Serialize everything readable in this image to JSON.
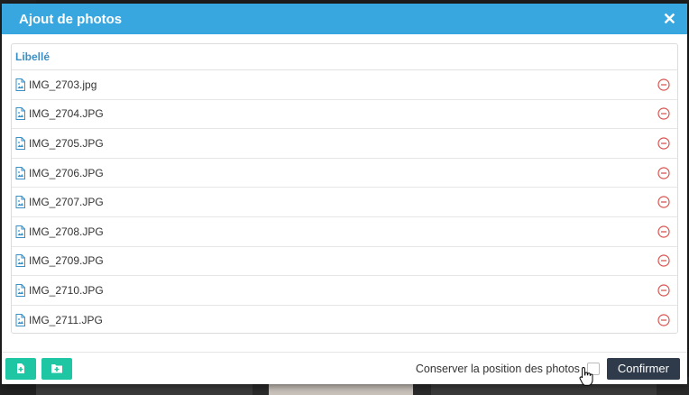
{
  "modal": {
    "title": "Ajout de photos",
    "close_icon": "close-icon"
  },
  "list": {
    "column_header": "Libellé",
    "files": [
      {
        "name": "IMG_2703.jpg"
      },
      {
        "name": "IMG_2704.JPG"
      },
      {
        "name": "IMG_2705.JPG"
      },
      {
        "name": "IMG_2706.JPG"
      },
      {
        "name": "IMG_2707.JPG"
      },
      {
        "name": "IMG_2708.JPG"
      },
      {
        "name": "IMG_2709.JPG"
      },
      {
        "name": "IMG_2710.JPG"
      },
      {
        "name": "IMG_2711.JPG"
      }
    ]
  },
  "footer": {
    "add_file_icon": "file-plus-icon",
    "add_folder_icon": "folder-plus-icon",
    "keep_position_label": "Conserver la position des photos",
    "keep_position_checked": false,
    "confirm_label": "Confirmer"
  },
  "colors": {
    "header": "#38a7e0",
    "accent_green": "#1fc6a4",
    "remove_red": "#d9534f",
    "confirm_dark": "#2f3b4a"
  }
}
